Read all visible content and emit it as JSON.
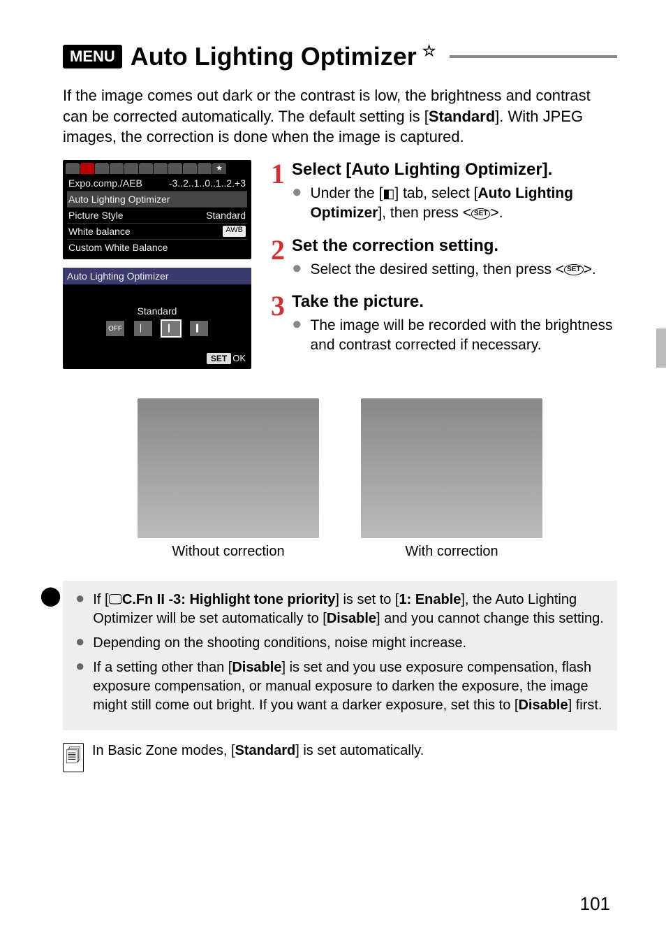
{
  "header": {
    "menu_badge": "MENU",
    "title": "Auto Lighting Optimizer",
    "star": "☆"
  },
  "intro": {
    "text_before_bold": "If the image comes out dark or the contrast is low, the brightness and contrast can be corrected automatically. The default setting is [",
    "bold": "Standard",
    "text_after_bold": "]. With JPEG images, the correction is done when the image is captured."
  },
  "screenshot1": {
    "rows": [
      {
        "label": "Expo.comp./AEB",
        "value": "-3..2..1..0..1..2.+3"
      },
      {
        "label": "Auto Lighting Optimizer",
        "value": ""
      },
      {
        "label": "Picture Style",
        "value": "Standard"
      },
      {
        "label": "White balance",
        "value": "AWB"
      },
      {
        "label": "Custom White Balance",
        "value": ""
      }
    ]
  },
  "screenshot2": {
    "title": "Auto Lighting Optimizer",
    "selected": "Standard",
    "ok_prefix": "SET",
    "ok": "OK"
  },
  "steps": {
    "s1": {
      "num": "1",
      "head": "Select [Auto Lighting Optimizer].",
      "bullet_pre": "Under the [",
      "bullet_mid": "] tab, select [",
      "bullet_bold": "Auto Lighting Optimizer",
      "bullet_post": "], then press <",
      "bullet_end": ">."
    },
    "s2": {
      "num": "2",
      "head": "Set the correction setting.",
      "bullet": "Select the desired setting, then press <",
      "bullet_end": ">."
    },
    "s3": {
      "num": "3",
      "head": "Take the picture.",
      "bullet": "The image will be recorded with the brightness and contrast corrected if necessary."
    }
  },
  "examples": {
    "left": "Without correction",
    "right": "With correction"
  },
  "caution": {
    "item1_pre": "If [",
    "item1_bold1": "C.Fn II -3: Highlight tone priority",
    "item1_mid": "] is set to [",
    "item1_bold2": "1: Enable",
    "item1_mid2": "], the Auto Lighting Optimizer will be set automatically to [",
    "item1_bold3": "Disable",
    "item1_post": "] and you cannot change this setting.",
    "item2": "Depending on the shooting conditions, noise might increase.",
    "item3_pre": "If a setting other than [",
    "item3_bold1": "Disable",
    "item3_mid": "] is set and you use exposure compensation, flash exposure compensation, or manual exposure to darken the exposure, the image might still come out bright. If you want a darker exposure, set this to [",
    "item3_bold2": "Disable",
    "item3_post": "] first."
  },
  "note": {
    "pre": "In Basic Zone modes, [",
    "bold": "Standard",
    "post": "] is set automatically."
  },
  "page_number": "101"
}
